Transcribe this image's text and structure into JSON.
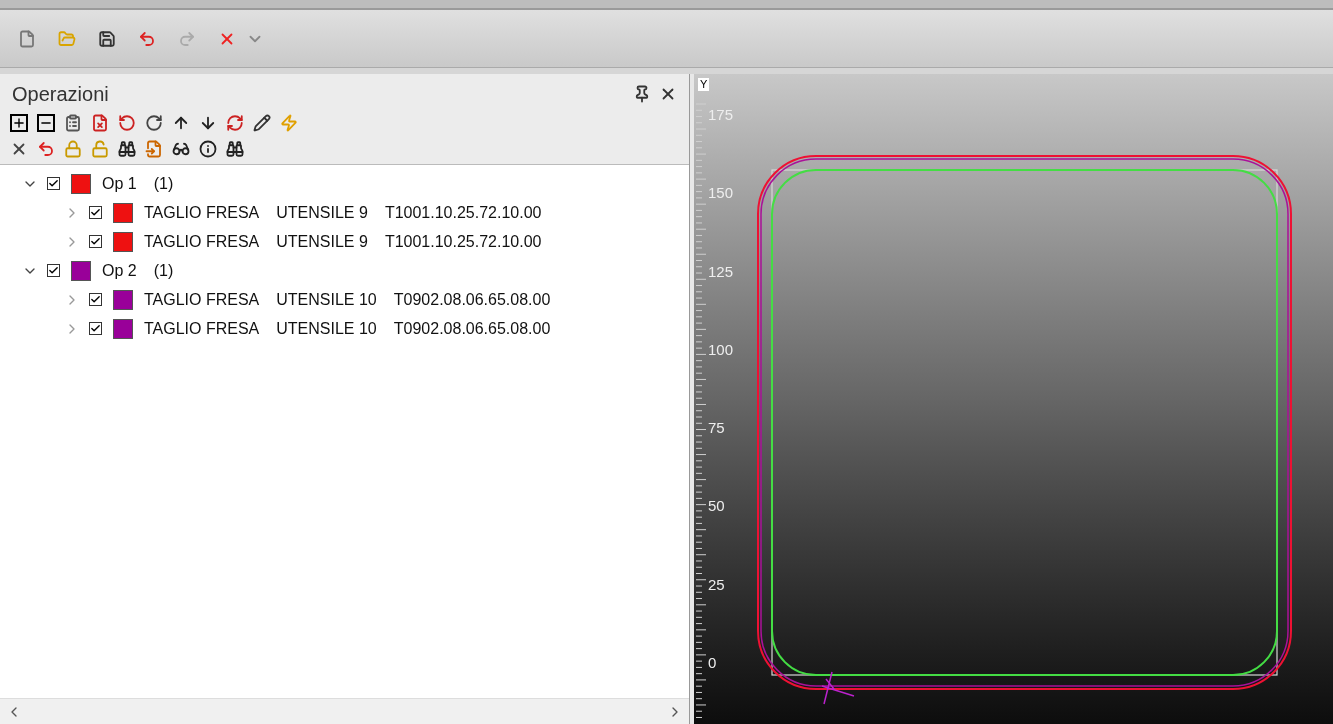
{
  "panel": {
    "title": "Operazioni"
  },
  "tree": [
    {
      "label": "Op 1",
      "count": "(1)",
      "color": "#ee1111",
      "checked": true,
      "expanded": true,
      "children": [
        {
          "name": "TAGLIO FRESA",
          "tool": "UTENSILE 9",
          "code": "T1001.10.25.72.10.00",
          "color": "#ee1111",
          "checked": true,
          "expanded": false
        },
        {
          "name": "TAGLIO FRESA",
          "tool": "UTENSILE 9",
          "code": "T1001.10.25.72.10.00",
          "color": "#ee1111",
          "checked": true,
          "expanded": false
        }
      ]
    },
    {
      "label": "Op 2",
      "count": "(1)",
      "color": "#990099",
      "checked": true,
      "expanded": true,
      "children": [
        {
          "name": "TAGLIO FRESA",
          "tool": "UTENSILE 10",
          "code": "T0902.08.06.65.08.00",
          "color": "#990099",
          "checked": true,
          "expanded": false
        },
        {
          "name": "TAGLIO FRESA",
          "tool": "UTENSILE 10",
          "code": "T0902.08.06.65.08.00",
          "color": "#990099",
          "checked": true,
          "expanded": false
        }
      ]
    }
  ],
  "viewport": {
    "axis_label": "Y",
    "ruler_labels": [
      "175",
      "150",
      "125",
      "100",
      "75",
      "50",
      "25",
      "0"
    ]
  }
}
